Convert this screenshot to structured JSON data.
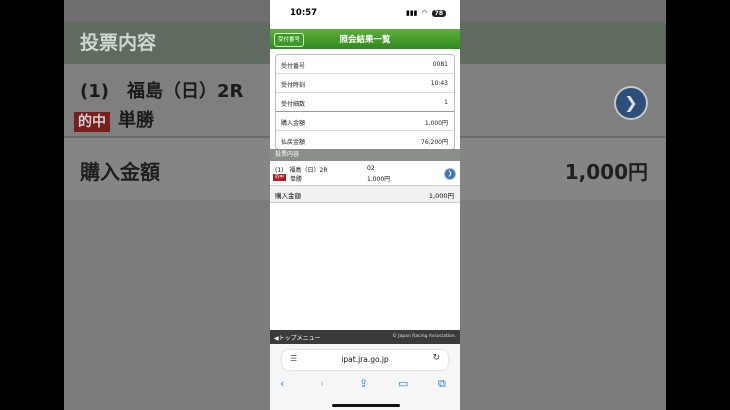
{
  "background": {
    "section_header": "投票内容",
    "bet_line": "(1)　福島（日）2R",
    "hit_badge": "的中",
    "bet_type": "単勝",
    "sum_label": "購入金額",
    "sum_value": "1,000円"
  },
  "status_bar": {
    "time": "10:57",
    "battery": "78"
  },
  "titlebar": {
    "button_label": "受付番号",
    "title": "照会結果一覧"
  },
  "info": [
    {
      "key": "受付番号",
      "value": "0081"
    },
    {
      "key": "受付時刻",
      "value": "10:43"
    },
    {
      "key": "受付細数",
      "value": "1"
    },
    {
      "key": "購入金額",
      "value": "1,000円"
    },
    {
      "key": "払戻金額",
      "value": "76,200円"
    }
  ],
  "bets_section": {
    "title": "投票内容"
  },
  "bet": {
    "line": "(1)　福島（日）2R",
    "horse_number": "02",
    "hit_badge": "的中",
    "type": "単勝",
    "amount": "1,000円"
  },
  "summary": {
    "label": "購入金額",
    "value": "1,000円"
  },
  "footer": {
    "menu_label": "トップメニュー",
    "copyright": "© Japan Racing Association."
  },
  "browser": {
    "url": "ipat.jra.go.jp"
  },
  "colors": {
    "title_green": "#2f8a1e",
    "hit_red": "#b01c1c",
    "link_blue": "#2b7de9"
  }
}
